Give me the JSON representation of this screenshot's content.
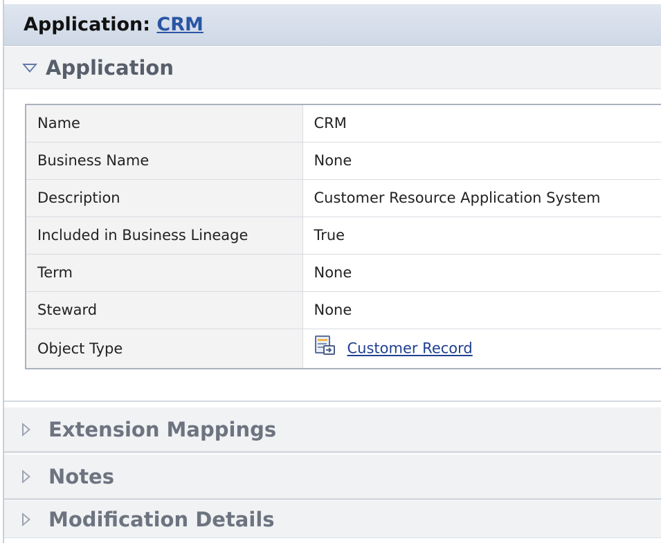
{
  "header": {
    "prefix": "Application: ",
    "link_text": "CRM"
  },
  "sections": {
    "application": {
      "title": "Application",
      "state": "expanded"
    },
    "extension_mappings": {
      "title": "Extension Mappings",
      "state": "collapsed"
    },
    "notes": {
      "title": "Notes",
      "state": "collapsed"
    },
    "modification_details": {
      "title": "Modification Details",
      "state": "collapsed"
    }
  },
  "properties": {
    "rows": [
      {
        "label": "Name",
        "value": "CRM"
      },
      {
        "label": "Business Name",
        "value": "None"
      },
      {
        "label": "Description",
        "value": "Customer Resource Application System"
      },
      {
        "label": "Included in Business Lineage",
        "value": "True"
      },
      {
        "label": "Term",
        "value": "None"
      },
      {
        "label": "Steward",
        "value": "None"
      },
      {
        "label": "Object Type",
        "value": "Customer Record",
        "icon": "customer-record-icon"
      }
    ]
  },
  "colors": {
    "header_link": "#2a55a4",
    "object_link": "#1f3f8f",
    "section_bg": "#f1f2f4",
    "expand_triangle": "#5f7aa6"
  },
  "icons": {
    "expanded": "triangle-down-icon",
    "collapsed": "triangle-right-icon"
  }
}
